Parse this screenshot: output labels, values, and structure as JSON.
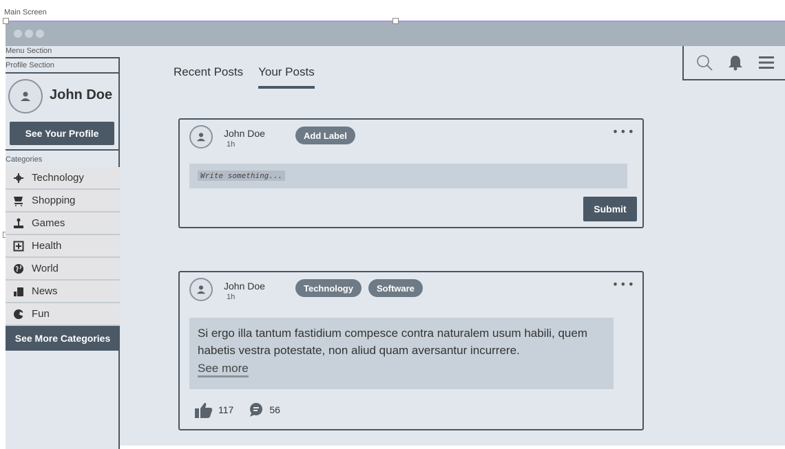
{
  "frame": {
    "main_screen_label": "Main Screen",
    "menu_section_label": "Menu Section",
    "profile_section_label": "Profile Section",
    "categories_label": "Categories"
  },
  "profile": {
    "name": "John Doe",
    "see_profile_label": "See Your Profile"
  },
  "categories": {
    "items": [
      {
        "label": "Technology",
        "icon": "satellite-icon"
      },
      {
        "label": "Shopping",
        "icon": "cart-icon"
      },
      {
        "label": "Games",
        "icon": "joystick-icon"
      },
      {
        "label": "Health",
        "icon": "plus-box-icon"
      },
      {
        "label": "World",
        "icon": "globe-icon"
      },
      {
        "label": "News",
        "icon": "news-icon"
      },
      {
        "label": "Fun",
        "icon": "fun-icon"
      }
    ],
    "see_more_label": "See More Categories"
  },
  "tabs": [
    {
      "label": "Recent Posts",
      "active": false
    },
    {
      "label": "Your Posts",
      "active": true
    }
  ],
  "composer": {
    "author": "John Doe",
    "time": "1h",
    "add_label": "Add Label",
    "placeholder": "Write something...",
    "submit_label": "Submit"
  },
  "post": {
    "author": "John Doe",
    "time": "1h",
    "labels": [
      "Technology",
      "Software"
    ],
    "body": "Si ergo illa tantum fastidium compesce contra naturalem usum habili, quem habetis vestra potestate, non aliud quam aversantur incurrere.",
    "see_more": "See more",
    "likes": "117",
    "comments": "56"
  },
  "colors": {
    "accent_dark": "#4b5866",
    "pill": "#6e7a86",
    "background": "#e2e7ee"
  }
}
